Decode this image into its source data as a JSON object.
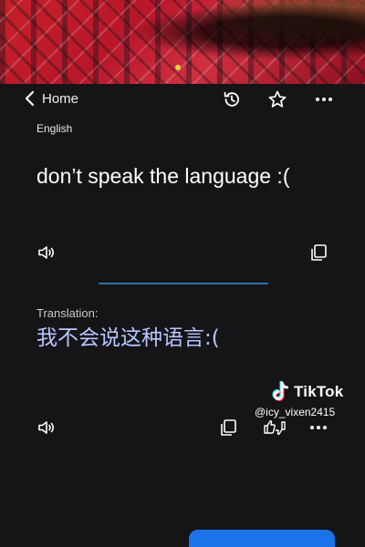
{
  "header": {
    "back_label": "Home",
    "icons": [
      "chevron-left-icon",
      "history-icon",
      "star-icon",
      "more-icon"
    ]
  },
  "source": {
    "language": "English",
    "text": "don’t speak the language :("
  },
  "translation": {
    "label": "Translation:",
    "text": "我不会说这种语言:("
  },
  "watermark": {
    "brand": "TikTok",
    "handle": "@icy_vixen2415"
  },
  "colors": {
    "background": "#151518",
    "translation_text": "#b8c6ff",
    "divider": "#2f6fa8",
    "button": "#1a73e8"
  }
}
